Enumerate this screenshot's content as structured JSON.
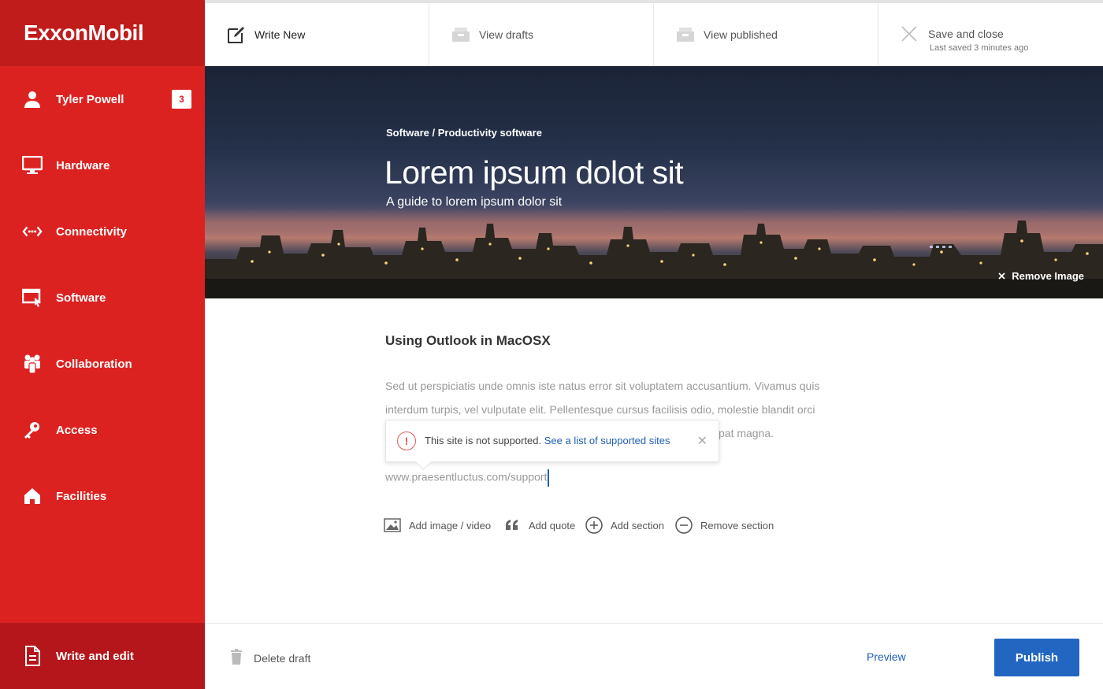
{
  "brand": {
    "logo_text": "ExxonMobil",
    "primary_color": "#dc2220",
    "dark_red": "#c01c1b",
    "accent_blue": "#2266c2"
  },
  "sidebar": {
    "items": [
      {
        "label": "Tyler Powell",
        "icon": "user-icon",
        "badge": "3"
      },
      {
        "label": "Hardware",
        "icon": "monitor-icon"
      },
      {
        "label": "Connectivity",
        "icon": "connectivity-icon"
      },
      {
        "label": "Software",
        "icon": "software-window-icon"
      },
      {
        "label": "Collaboration",
        "icon": "people-icon"
      },
      {
        "label": "Access",
        "icon": "key-icon"
      },
      {
        "label": "Facilities",
        "icon": "home-icon"
      }
    ],
    "bottom_item": {
      "label": "Write and edit",
      "icon": "document-icon"
    }
  },
  "topbar": {
    "tabs": [
      {
        "label": "Write New",
        "icon": "edit-icon",
        "active": true
      },
      {
        "label": "View drafts",
        "icon": "inbox-tray-icon"
      },
      {
        "label": "View published",
        "icon": "inbox-tray-icon"
      }
    ],
    "save": {
      "label": "Save and close",
      "sub": "Last saved 3 minutes ago",
      "icon": "close-icon"
    }
  },
  "hero": {
    "breadcrumb": "Software / Productivity software",
    "title": "Lorem ipsum dolot sit",
    "subtitle": "A guide to lorem ipsum dolor sit",
    "remove_image_label": "Remove Image"
  },
  "content": {
    "section_title": "Using Outlook in MacOSX",
    "body_line1": "Sed ut perspiciatis unde omnis iste natus error sit voluptatem accusantium. Vivamus quis",
    "body_line2": "interdum turpis, vel vulputate elit. Pellentesque cursus facilisis odio, molestie blandit orci",
    "body_line3_tail": "pat magna.",
    "url_input_value": "www.praesentluctus.com/support"
  },
  "tooltip": {
    "message": "This site is not supported.",
    "link_text": "See a list of supported sites",
    "icon": "warning-icon"
  },
  "toolbar": {
    "add_image": "Add image / video",
    "add_quote": "Add quote",
    "add_section": "Add section",
    "remove_section": "Remove section"
  },
  "footer": {
    "delete_label": "Delete draft",
    "preview_label": "Preview",
    "publish_label": "Publish"
  }
}
